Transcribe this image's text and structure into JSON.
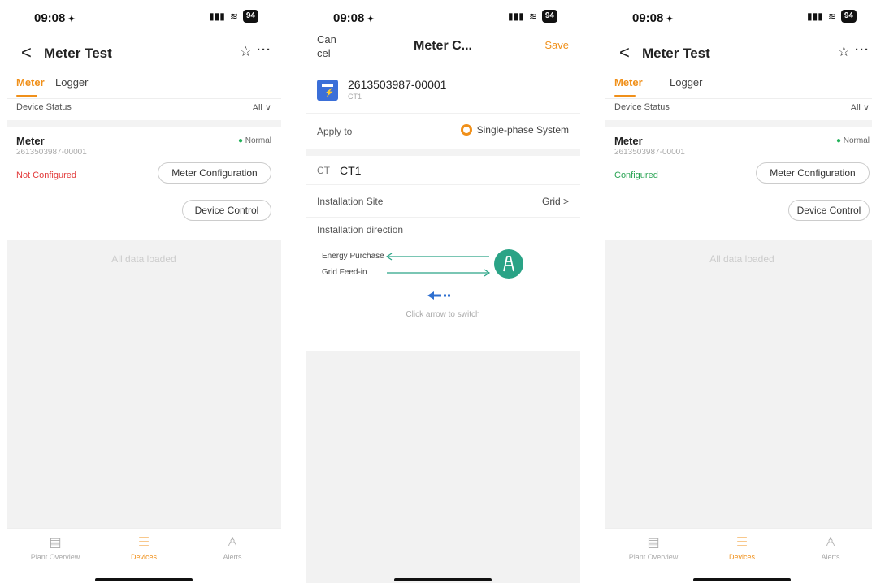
{
  "status": {
    "time": "09:08",
    "bell": "🔕",
    "signal": "::!",
    "wifi": "📶",
    "battery": "94"
  },
  "list": {
    "back": "<",
    "title": "Meter Test",
    "star": "☆",
    "more": "···",
    "tabs": [
      "Meter",
      "Logger"
    ],
    "filter_label": "Device Status",
    "filter_value": "All ∨",
    "device": {
      "name": "Meter",
      "sn": "2613503987-00001",
      "state": "Normal",
      "cfg_before": "Not Configured",
      "cfg_after": "Configured",
      "meter_cfg_btn": "Meter Configuration",
      "device_ctrl_btn": "Device Control"
    },
    "loaded": "All data loaded"
  },
  "tabbar": {
    "items": [
      {
        "label": "Plant Overview",
        "icon": "🖥"
      },
      {
        "label": "Devices",
        "icon": "☰"
      },
      {
        "label": "Alerts",
        "icon": "🔔"
      }
    ]
  },
  "config": {
    "cancel": "Can cel",
    "cancel_l1": "Can",
    "cancel_l2": "cel",
    "title": "Meter C...",
    "save": "Save",
    "sn": "2613503987-00001",
    "ct_sub": "CT1",
    "apply_label": "Apply to",
    "apply_value": "Single-phase System",
    "ct_key": "CT",
    "ct_value": "CT1",
    "site_label": "Installation Site",
    "site_value": "Grid  >",
    "dir_label": "Installation direction",
    "energy_purchase": "Energy Purchase",
    "grid_feed_in": "Grid Feed-in",
    "hint": "Click arrow to switch"
  },
  "colors": {
    "accent": "#f0901a",
    "normal": "#23b25a",
    "error": "#e23b3b",
    "teal": "#2aa386",
    "arrow": "#2e6fd0"
  }
}
